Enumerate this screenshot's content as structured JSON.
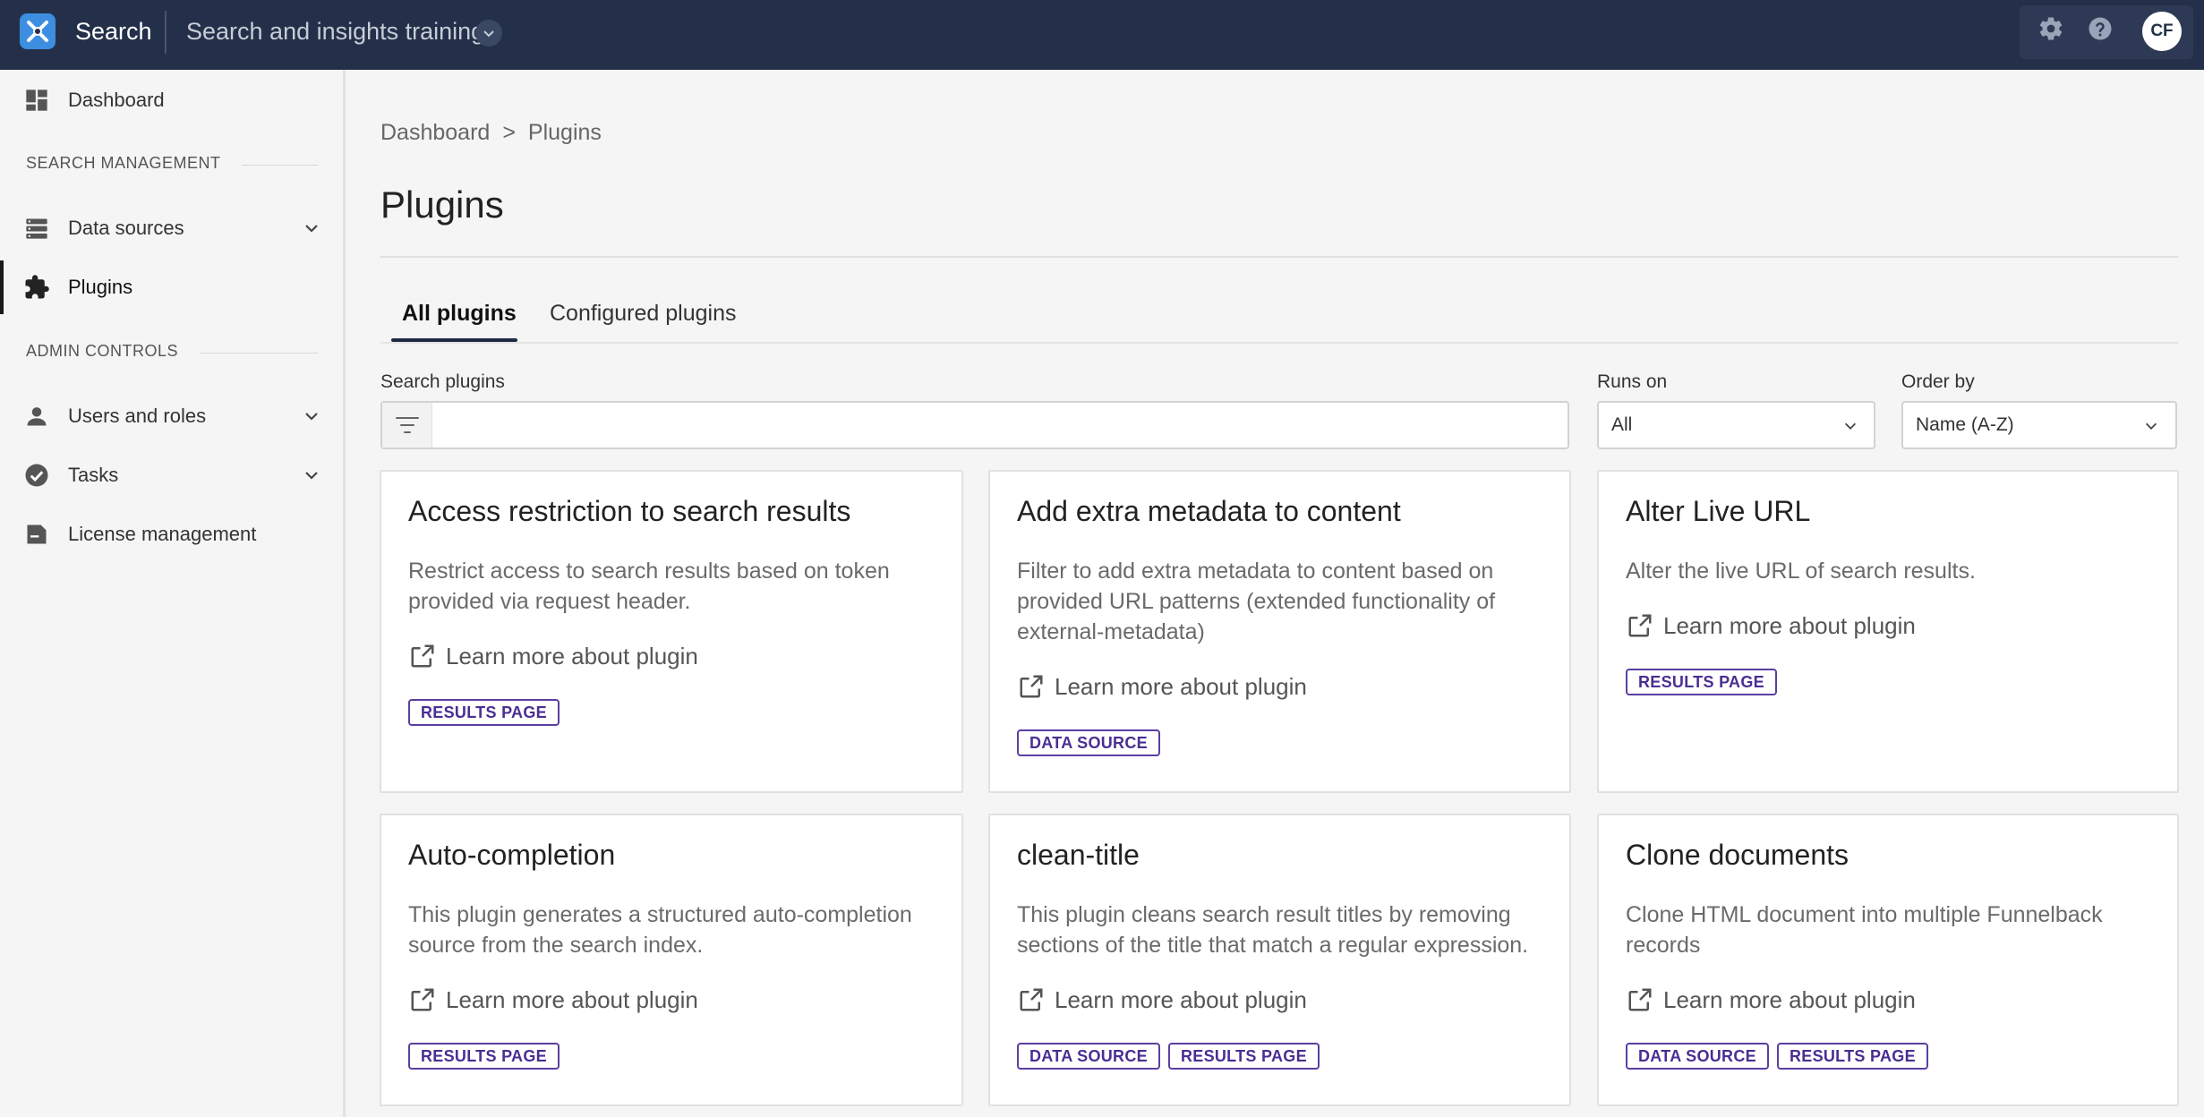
{
  "topbar": {
    "app_name": "Search",
    "context_name": "Search and insights training",
    "avatar_initials": "CF",
    "colors": {
      "bar": "#243049",
      "logo": "#3d8de0"
    }
  },
  "sidebar": {
    "items": [
      {
        "label": "Dashboard",
        "icon": "dashboard-icon"
      },
      {
        "label": "Data sources",
        "icon": "database-icon",
        "expandable": true
      },
      {
        "label": "Plugins",
        "icon": "puzzle-icon",
        "active": true
      },
      {
        "label": "Users and roles",
        "icon": "user-icon",
        "expandable": true
      },
      {
        "label": "Tasks",
        "icon": "check-circle-icon",
        "expandable": true
      },
      {
        "label": "License management",
        "icon": "license-icon"
      }
    ],
    "sections": {
      "search_management": "SEARCH MANAGEMENT",
      "admin_controls": "ADMIN CONTROLS"
    }
  },
  "breadcrumb": {
    "root": "Dashboard",
    "separator": ">",
    "current": "Plugins"
  },
  "page": {
    "title": "Plugins"
  },
  "tabs": [
    {
      "label": "All plugins",
      "active": true
    },
    {
      "label": "Configured plugins",
      "active": false
    }
  ],
  "filters": {
    "search_label": "Search plugins",
    "search_value": "",
    "runs_on_label": "Runs on",
    "runs_on_value": "All",
    "order_by_label": "Order by",
    "order_by_value": "Name (A-Z)"
  },
  "cards": [
    {
      "title": "Access restriction to search results",
      "description": "Restrict access to search results based on token provided via request header.",
      "link": "Learn more about plugin",
      "tags": [
        "RESULTS PAGE"
      ]
    },
    {
      "title": "Add extra metadata to content",
      "description": "Filter to add extra metadata to content based on provided URL patterns (extended functionality of external-metadata)",
      "link": "Learn more about plugin",
      "tags": [
        "DATA SOURCE"
      ]
    },
    {
      "title": "Alter Live URL",
      "description": "Alter the live URL of search results.",
      "link": "Learn more about plugin",
      "tags": [
        "RESULTS PAGE"
      ]
    },
    {
      "title": "Auto-completion",
      "description": "This plugin generates a structured auto-completion source from the search index.",
      "link": "Learn more about plugin",
      "tags": [
        "RESULTS PAGE"
      ]
    },
    {
      "title": "clean-title",
      "description": "This plugin cleans search result titles by removing sections of the title that match a regular expression.",
      "link": "Learn more about plugin",
      "tags": [
        "DATA SOURCE",
        "RESULTS PAGE"
      ]
    },
    {
      "title": "Clone documents",
      "description": "Clone HTML document into multiple Funnelback records",
      "link": "Learn more about plugin",
      "tags": [
        "DATA SOURCE",
        "RESULTS PAGE"
      ]
    }
  ]
}
